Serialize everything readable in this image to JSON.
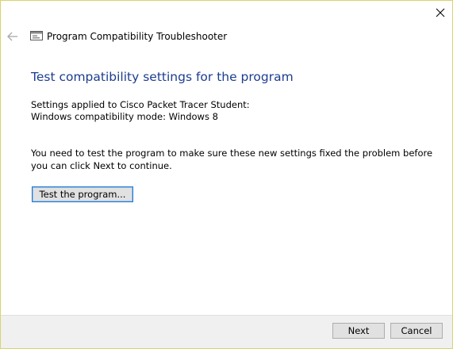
{
  "window": {
    "close_icon": "close-icon",
    "back_icon": "back-arrow-icon",
    "app_icon": "program-compatibility-icon",
    "title": "Program Compatibility Troubleshooter"
  },
  "content": {
    "heading": "Test compatibility settings for the program",
    "settings_applied": "Settings applied to Cisco Packet Tracer Student:",
    "compatibility_mode": "Windows compatibility mode: Windows 8",
    "instruction": "You need to test the program to make sure these new settings fixed the problem before you can click Next to continue.",
    "test_button_label": "Test the program..."
  },
  "footer": {
    "next_label": "Next",
    "cancel_label": "Cancel"
  },
  "colors": {
    "heading": "#1c3d8f",
    "window_border": "#d8d46e",
    "footer_bg": "#f0f0f0",
    "focus_border": "#2f77c9"
  }
}
